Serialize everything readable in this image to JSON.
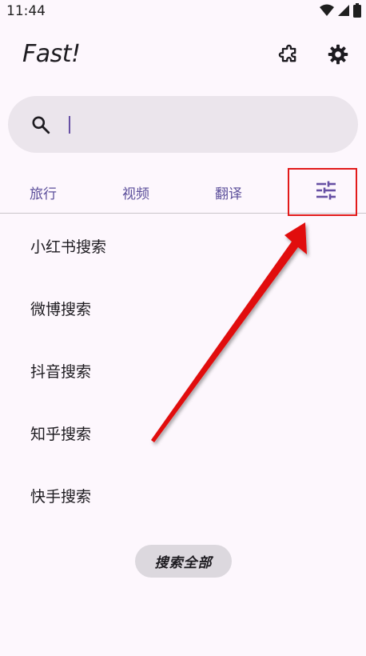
{
  "status_bar": {
    "time": "11:44"
  },
  "header": {
    "title": "Fast!"
  },
  "search": {
    "value": "",
    "placeholder": ""
  },
  "tabs": [
    {
      "label": "旅行"
    },
    {
      "label": "视频"
    },
    {
      "label": "翻译"
    }
  ],
  "list": {
    "items": [
      {
        "label": "小红书搜索"
      },
      {
        "label": "微博搜索"
      },
      {
        "label": "抖音搜索"
      },
      {
        "label": "知乎搜索"
      },
      {
        "label": "快手搜索"
      }
    ]
  },
  "footer": {
    "search_all_label": "搜索全部"
  },
  "colors": {
    "accent": "#6750a4",
    "tab_text": "#5b4e9a",
    "background": "#fdf7fd",
    "search_bg": "#ebe5ec",
    "annotation": "#e21a1a"
  }
}
